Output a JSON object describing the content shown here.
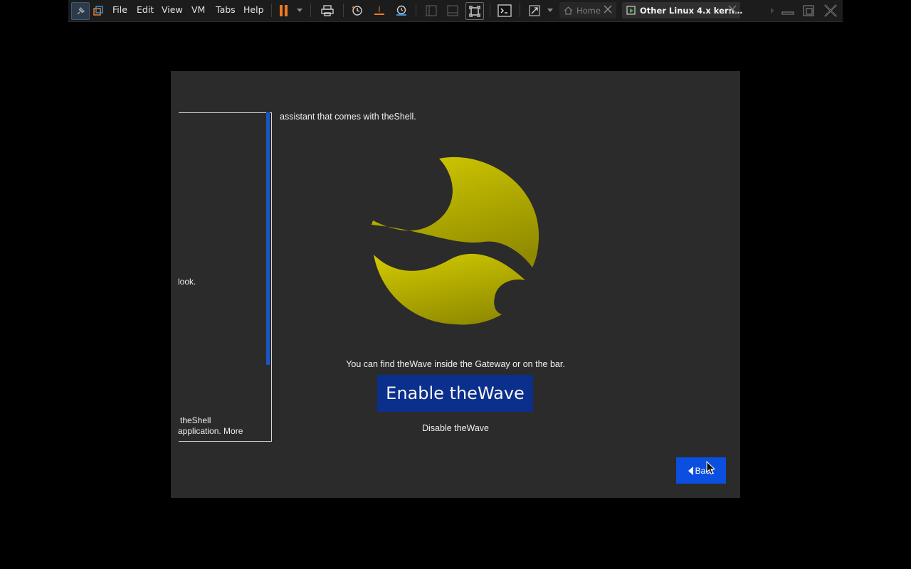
{
  "toolbar": {
    "menu": [
      "File",
      "Edit",
      "View",
      "VM",
      "Tabs",
      "Help"
    ],
    "icons": [
      "pin-icon",
      "library-icon",
      "pause-icon",
      "send-keys-icon",
      "snapshot-icon",
      "revert-snapshot-icon",
      "snapshot-manager-icon",
      "console-view-icon",
      "thumbnail-view-icon",
      "fit-guest-icon",
      "terminal-icon",
      "fullscreen-icon",
      "minimize-icon",
      "restore-icon",
      "close-icon"
    ],
    "tabs": [
      {
        "label": "Home",
        "icon": "home-icon",
        "active": false
      },
      {
        "label": "Other Linux 4.x kern…",
        "icon": "vm-icon",
        "active": true
      }
    ],
    "accent_color": "#f07a20"
  },
  "guest": {
    "side_panel": {
      "line_1": "look.",
      "line_2": "theShell",
      "line_3": "application. More"
    },
    "intro": "assistant that comes with theShell.",
    "logo": "thewave-logo",
    "logo_color": "#c9c200",
    "find_text": "You can find theWave inside the Gateway or on the bar.",
    "enable_label": "Enable theWave",
    "disable_label": "Disable theWave",
    "back_label": "Back",
    "colors": {
      "background": "#2b2b2b",
      "enable_button": "#0a2f8c",
      "back_button": "#0a4fe0",
      "scrollbar": "#1a57c4"
    }
  }
}
